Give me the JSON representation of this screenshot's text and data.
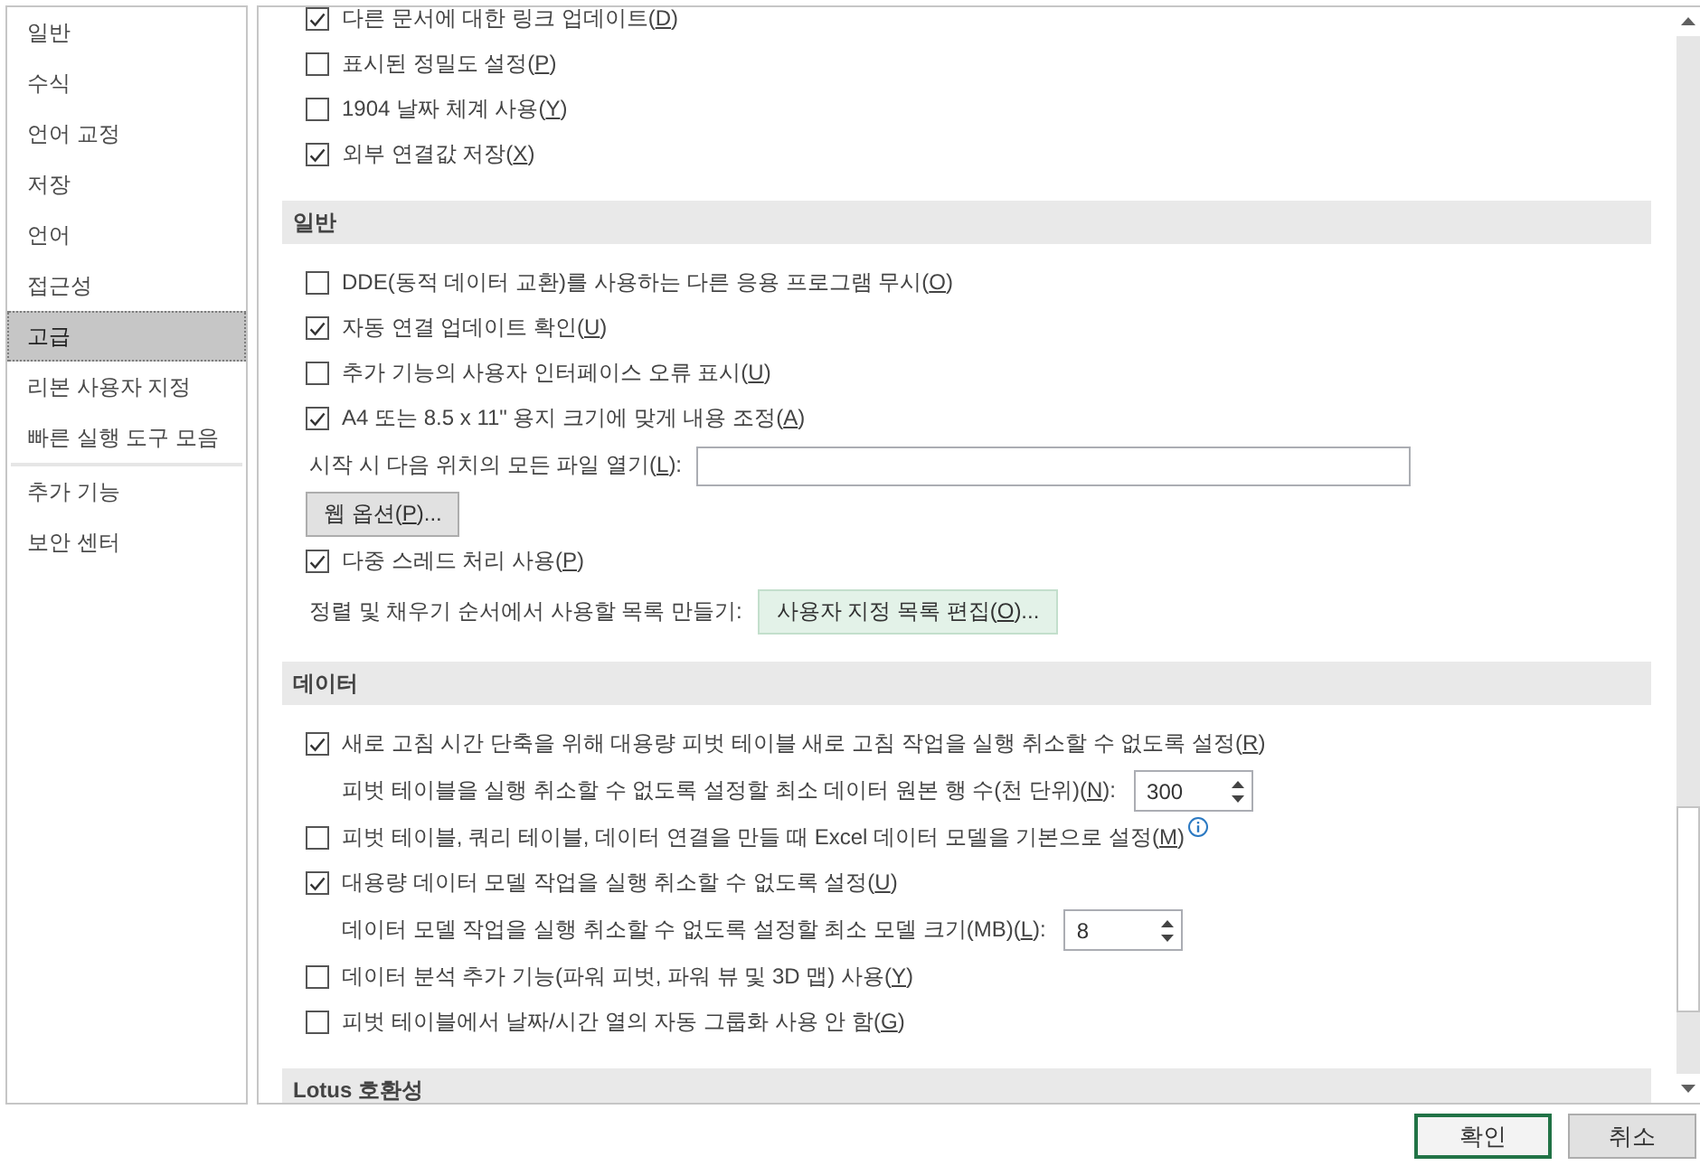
{
  "sidebar": {
    "groups": [
      {
        "items": [
          {
            "label": "일반",
            "selected": false
          },
          {
            "label": "수식",
            "selected": false
          },
          {
            "label": "언어 교정",
            "selected": false
          },
          {
            "label": "저장",
            "selected": false
          },
          {
            "label": "언어",
            "selected": false
          },
          {
            "label": "접근성",
            "selected": false
          },
          {
            "label": "고급",
            "selected": true
          },
          {
            "label": "리본 사용자 지정",
            "selected": false
          },
          {
            "label": "빠른 실행 도구 모음",
            "selected": false
          }
        ]
      },
      {
        "items": [
          {
            "label": "추가 기능",
            "selected": false
          },
          {
            "label": "보안 센터",
            "selected": false
          }
        ]
      }
    ]
  },
  "content": {
    "items": [
      {
        "kind": "checkbox",
        "checked": true,
        "label": [
          "다른 문서에 대한 링크 업데이트(",
          "D",
          ")"
        ]
      },
      {
        "kind": "checkbox",
        "checked": false,
        "label": [
          "표시된 정밀도 설정(",
          "P",
          ")"
        ]
      },
      {
        "kind": "checkbox",
        "checked": false,
        "label": [
          "1904 날짜 체계 사용(",
          "Y",
          ")"
        ]
      },
      {
        "kind": "checkbox",
        "checked": true,
        "label": [
          "외부 연결값 저장(",
          "X",
          ")"
        ]
      },
      {
        "kind": "header",
        "label": "일반"
      },
      {
        "kind": "checkbox",
        "checked": false,
        "label": [
          "DDE(동적 데이터 교환)를 사용하는 다른 응용 프로그램 무시(",
          "O",
          ")"
        ]
      },
      {
        "kind": "checkbox",
        "checked": true,
        "label": [
          "자동 연결 업데이트 확인(",
          "U",
          ")"
        ]
      },
      {
        "kind": "checkbox",
        "checked": false,
        "label": [
          "추가 기능의 사용자 인터페이스 오류 표시(",
          "U",
          ")"
        ]
      },
      {
        "kind": "checkbox",
        "checked": true,
        "label": [
          "A4 또는 8.5 x 11\" 용지 크기에 맞게 내용 조정(",
          "A",
          ")"
        ]
      },
      {
        "kind": "text_field",
        "label": [
          "시작 시 다음 위치의 모든 파일 열기(",
          "L",
          "):"
        ]
      },
      {
        "kind": "button",
        "label": [
          "웹 옵션(",
          "P",
          ")..."
        ]
      },
      {
        "kind": "checkbox",
        "checked": true,
        "label": [
          "다중 스레드 처리 사용(",
          "P",
          ")"
        ]
      },
      {
        "kind": "label_button",
        "label": [
          "정렬 및 채우기 순서에서 사용할 목록 만들기:"
        ],
        "button": [
          "사용자 지정 목록 편집(",
          "O",
          ")..."
        ],
        "highlighted": true
      },
      {
        "kind": "header",
        "label": "데이터"
      },
      {
        "kind": "checkbox",
        "checked": true,
        "label": [
          "새로 고침 시간 단축을 위해 대용량 피벗 테이블 새로 고침 작업을 실행 취소할 수 없도록 설정(",
          "R",
          ")"
        ]
      },
      {
        "kind": "spin_field",
        "label": [
          "피벗 테이블을 실행 취소할 수 없도록 설정할 최소 데이터 원본 행 수(천 단위)(",
          "N",
          "):"
        ],
        "value": "300"
      },
      {
        "kind": "checkbox",
        "checked": false,
        "info": true,
        "label": [
          "피벗 테이블, 쿼리 테이블, 데이터 연결을 만들 때 Excel 데이터 모델을 기본으로 설정(",
          "M",
          ")"
        ]
      },
      {
        "kind": "checkbox",
        "checked": true,
        "label": [
          "대용량 데이터 모델 작업을 실행 취소할 수 없도록 설정(",
          "U",
          ")"
        ]
      },
      {
        "kind": "spin_field",
        "label": [
          "데이터 모델 작업을 실행 취소할 수 없도록 설정할 최소 모델 크기(MB)(",
          "L",
          "):"
        ],
        "value": "8"
      },
      {
        "kind": "checkbox",
        "checked": false,
        "label": [
          "데이터 분석 추가 기능(파워 피벗, 파워 뷰 및 3D 맵) 사용(",
          "Y",
          ")"
        ]
      },
      {
        "kind": "checkbox",
        "checked": false,
        "label": [
          "피벗 테이블에서 날짜/시간 열의 자동 그룹화 사용 안 함(",
          "G",
          ")"
        ]
      },
      {
        "kind": "header",
        "label": "Lotus 호환성"
      }
    ]
  },
  "footer_buttons": [
    {
      "label": "확인",
      "default": true
    },
    {
      "label": "취소",
      "default": false
    }
  ]
}
